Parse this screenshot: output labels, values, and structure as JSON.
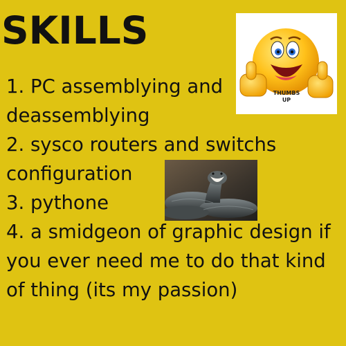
{
  "title": "SKILLS",
  "lines": [
    "1. PC assemblying and",
    "deassemblying",
    "2. sysco routers and switchs",
    "configuration",
    "3. pythone",
    "4. a smidgeon of graphic design if",
    "you ever need me to do that kind",
    "of thing (its my passion)"
  ],
  "emoji_image": {
    "label": "THUMBS",
    "label2": "UP",
    "icon": "thumbs-up-smiley-icon"
  },
  "snake_image": {
    "icon": "snake-photo-icon"
  },
  "colors": {
    "background": "#dfc312",
    "text": "#111111"
  }
}
